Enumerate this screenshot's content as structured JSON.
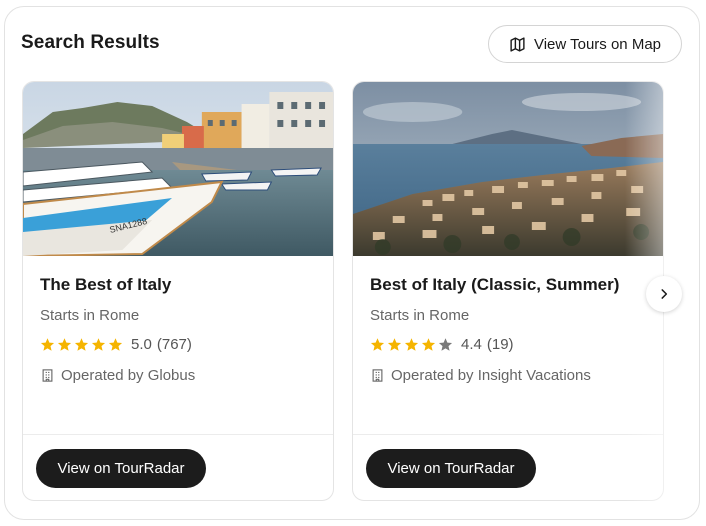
{
  "header": {
    "title": "Search Results",
    "map_button_label": "View Tours on Map",
    "map_icon": "map-icon"
  },
  "cards": [
    {
      "title": "The Best of Italy",
      "start": "Starts in Rome",
      "rating": "5.0",
      "reviews": "(767)",
      "stars_filled": 5,
      "operator": "Operated by Globus",
      "button_label": "View on TourRadar",
      "image_subject": "harbor-boats-photo"
    },
    {
      "title": "Best of Italy (Classic, Summer)",
      "start": "Starts in Rome",
      "rating": "4.4",
      "reviews": "(19)",
      "stars_filled": 4,
      "operator": "Operated by Insight Vacations",
      "button_label": "View on TourRadar",
      "image_subject": "coastal-town-photo"
    }
  ],
  "colors": {
    "star_filled": "#f5b400",
    "star_empty": "#7a7a7a",
    "button_bg": "#1c1c1c",
    "border": "#e2e2e2"
  }
}
